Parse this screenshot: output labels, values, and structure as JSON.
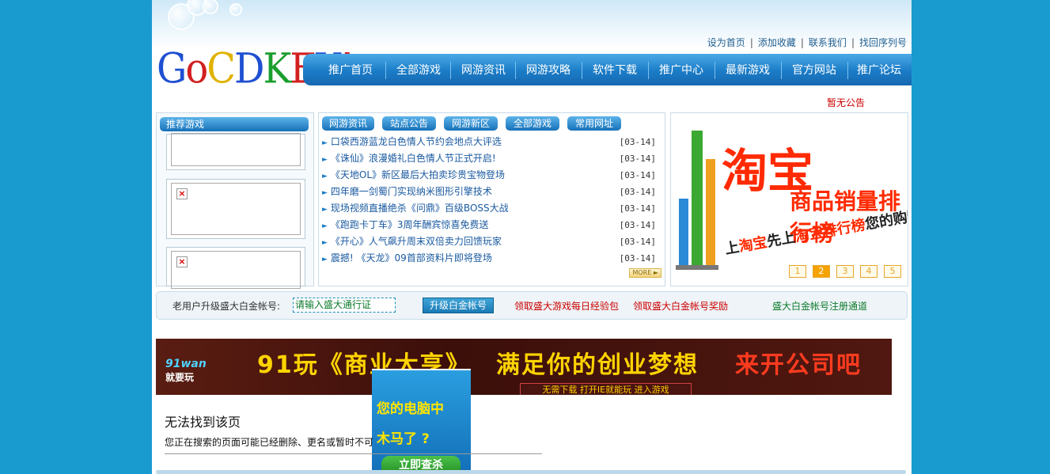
{
  "logo": {
    "letters": [
      "G",
      "o",
      "C",
      "D",
      "K",
      "E",
      "Y",
      "!"
    ],
    "colors": [
      "#1f4fd1",
      "#d22020",
      "#e0b200",
      "#1f4fd1",
      "#1b9e2e",
      "#d22020",
      "#1f4fd1",
      "#d22020"
    ]
  },
  "top_links": [
    "设为首页",
    "添加收藏",
    "联系我们",
    "找回序列号"
  ],
  "nav": [
    "推广首页",
    "全部游戏",
    "网游资讯",
    "网游攻略",
    "软件下载",
    "推广中心",
    "最新游戏",
    "官方网站",
    "推广论坛"
  ],
  "notice": "暂无公告",
  "left_box": {
    "title": "推荐游戏"
  },
  "mid_tabs": [
    "网游资讯",
    "站点公告",
    "网游新区",
    "全部游戏",
    "常用网址"
  ],
  "news": [
    {
      "title": "口袋西游蓝龙白色情人节约会地点大评选",
      "date": "[03-14]"
    },
    {
      "title": "《诛仙》浪漫婚礼白色情人节正式开启!",
      "date": "[03-14]"
    },
    {
      "title": "《天地OL》新区最后大拍卖珍贵宝物登场",
      "date": "[03-14]"
    },
    {
      "title": "四年磨一剑蜀门实现纳米图形引擎技术",
      "date": "[03-14]"
    },
    {
      "title": "现场视频直播绝杀《问鼎》百级BOSS大战",
      "date": "[03-14]"
    },
    {
      "title": "《跑跑卡丁车》3周年酬宾惊喜免费送",
      "date": "[03-14]"
    },
    {
      "title": "《开心》人气飙升周末双倍卖力回馈玩家",
      "date": "[03-14]"
    },
    {
      "title": "震撼! 《天龙》09首部资料片即将登场",
      "date": "[03-14]"
    }
  ],
  "more_label": "MORE",
  "taobao_ad": {
    "big_char": "淘宝",
    "title": "商品销量排行榜",
    "slogan_1": "上",
    "slogan_2": "淘宝",
    "slogan_3": "先上",
    "slogan_4": "淘宝排行榜",
    "slogan_5": "您的购物好助手!",
    "pages": [
      "1",
      "2",
      "3",
      "4",
      "5"
    ],
    "active_page": "2"
  },
  "upgrade": {
    "label": "老用户升级盛大白金帐号:",
    "input_value": "请输入盛大通行证",
    "button": "升级白金帐号",
    "link1": "领取盛大游戏每日经验包",
    "link2": "领取盛大白金帐号奖励",
    "link3": "盛大白金帐号注册通道"
  },
  "banner": {
    "brand_top": "91wan",
    "brand_bottom": "就要玩",
    "part1": "91玩《商业大亨》",
    "part2": "满足你的创业梦想",
    "part3": "来开公司吧",
    "sub": "无需下载 打开IE就能玩  进入游戏"
  },
  "trojan_ad": {
    "line1": "您的电脑中",
    "line2": "木马了 ?",
    "button": "立即查杀"
  },
  "error": {
    "title": "无法找到该页",
    "message": "您正在搜索的页面可能已经删除、更名或暂时不可"
  },
  "colors": {
    "background": "#1a9bd0",
    "nav": "#1b7cc7",
    "notice": "#cc0000",
    "link_red": "#cc0000",
    "link_green": "#0d7a2c"
  }
}
